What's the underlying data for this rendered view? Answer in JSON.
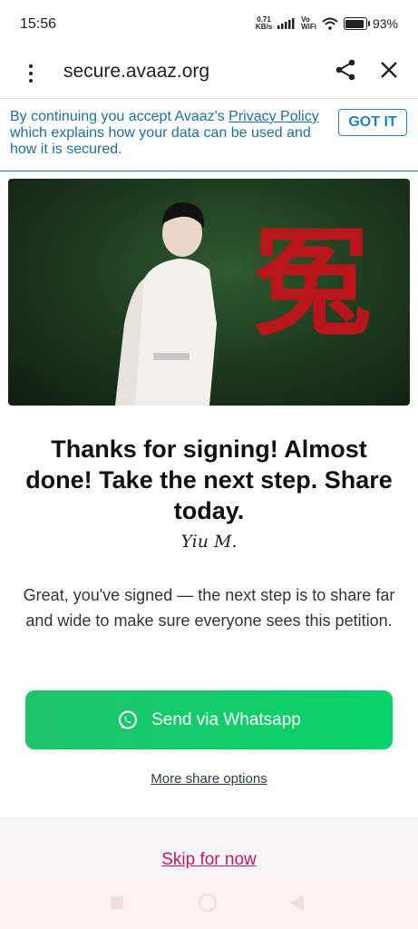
{
  "status_bar": {
    "time": "15:56",
    "net_speed_value": "0.71",
    "net_speed_unit": "KB/s",
    "volte_top": "Vo",
    "volte_bottom": "WiFi",
    "battery_percent": "93%",
    "battery_level": 0.93
  },
  "toolbar": {
    "url": "secure.avaaz.org",
    "menu_icon": "kebab-menu-icon",
    "share_icon": "share-icon",
    "close_icon": "close-icon"
  },
  "cookie_banner": {
    "text_before": "By continuing you accept Avaaz's ",
    "link": "Privacy Policy",
    "text_after": " which explains how your data can be used and how it is secured.",
    "button": "GOT IT"
  },
  "hero": {
    "calligraphy": "冤"
  },
  "main": {
    "title": "Thanks for signing! Almost done! Take the next step. Share today.",
    "signature": "Yiu M.",
    "description": "Great, you've signed — the next step is to share far and wide to make sure everyone sees this petition.",
    "whatsapp_button": "Send via Whatsapp",
    "more_share": "More share options",
    "skip": "Skip for now"
  },
  "colors": {
    "whatsapp_green": "#08d26a",
    "link_blue": "#1f6fa0",
    "skip_pink": "#c4166b"
  }
}
